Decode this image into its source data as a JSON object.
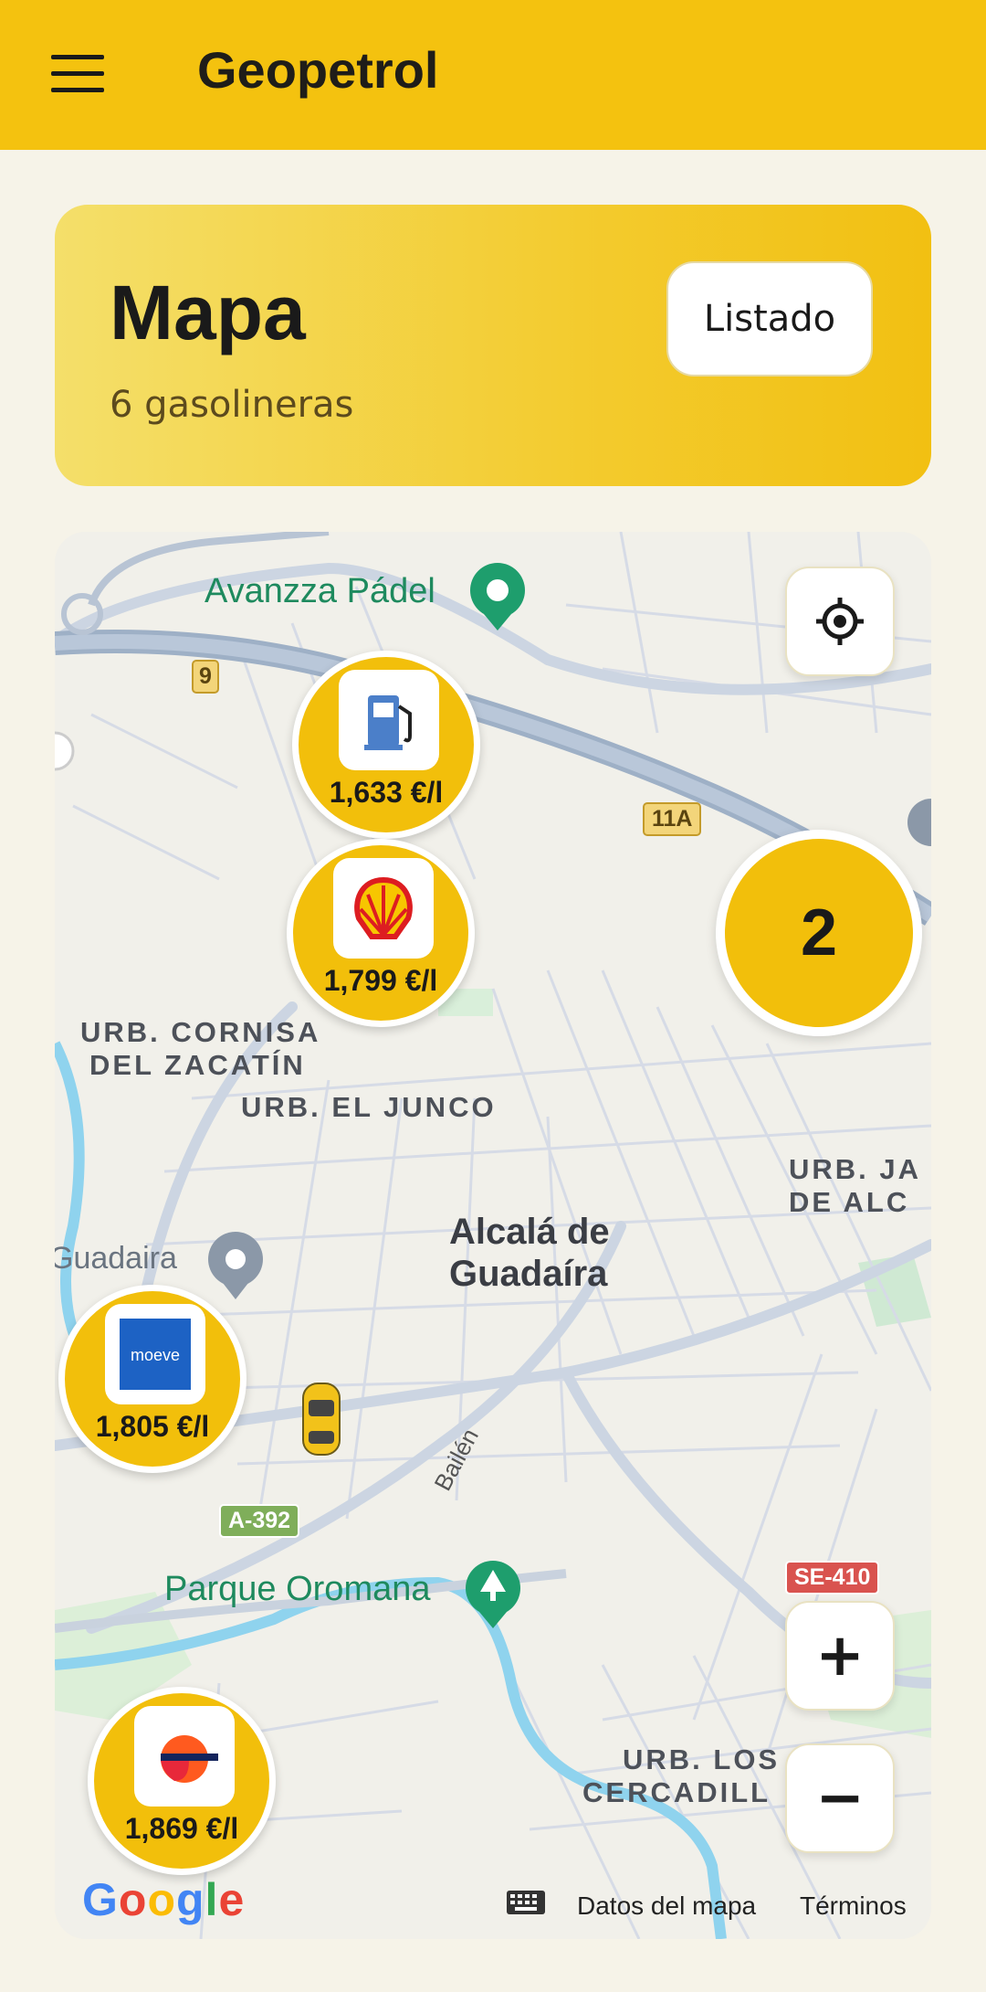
{
  "app": {
    "title": "Geopetrol"
  },
  "header": {
    "title": "Mapa",
    "subtitle": "6 gasolineras",
    "list_button": "Listado"
  },
  "map": {
    "labels": {
      "padel": "Avanzza Pádel",
      "parque": "Parque Oromana",
      "urb_cornisa_1": "URB. CORNISA",
      "urb_cornisa_2": "DEL ZACATÍN",
      "urb_junco": "URB. EL JUNCO",
      "city_1": "Alcalá de",
      "city_2": "Guadaíra",
      "guadaira_left": "Guadaira",
      "urb_ja_1": "URB. JA",
      "urb_ja_2": "DE ALC",
      "urb_los_1": "URB. LOS",
      "urb_los_2": "CERCADILL",
      "bailen": "Bailén"
    },
    "road_shields": {
      "r9": "9",
      "r11a": "11A",
      "a392": "A-392",
      "se410": "SE-410"
    },
    "markers": [
      {
        "brand": "generic-fuel",
        "price": "1,633 €/l"
      },
      {
        "brand": "shell",
        "price": "1,799 €/l"
      },
      {
        "brand": "moeve",
        "price": "1,805 €/l",
        "logo_text": "moeve"
      },
      {
        "brand": "repsol",
        "price": "1,869 €/l"
      }
    ],
    "cluster": {
      "count": "2"
    },
    "controls": {
      "zoom_in": "+",
      "zoom_out": "−"
    },
    "attribution": {
      "google": "Google",
      "map_data": "Datos del mapa",
      "terms": "Términos"
    },
    "colors": {
      "accent": "#f2bf0b",
      "water": "#8fd3ee",
      "motorway": "#aab9cd",
      "park": "#c7e8cc"
    }
  }
}
